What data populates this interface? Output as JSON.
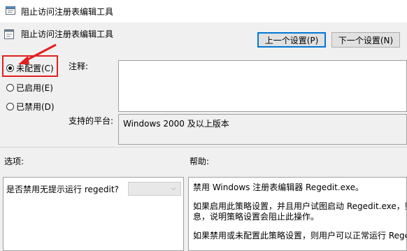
{
  "window": {
    "title": "阻止访问注册表编辑工具"
  },
  "header": {
    "title": "阻止访问注册表编辑工具"
  },
  "buttons": {
    "prev": "上一个设置(P)",
    "next": "下一个设置(N)"
  },
  "radios": [
    {
      "label": "未配置(C)",
      "checked": true
    },
    {
      "label": "已启用(E)",
      "checked": false
    },
    {
      "label": "已禁用(D)",
      "checked": false
    }
  ],
  "comment": {
    "label": "注释:",
    "value": ""
  },
  "platform": {
    "label": "支持的平台:",
    "value": "Windows 2000 及以上版本"
  },
  "options": {
    "label": "选项:",
    "item_label": "是否禁用无提示运行 regedit?",
    "dropdown_value": ""
  },
  "help": {
    "label": "帮助:",
    "lines": [
      "禁用 Windows 注册表编辑器 Regedit.exe。",
      "如果启用此策略设置，并且用户试图启动 Regedit.exe，则会",
      "息，说明策略设置会阻止此操作。",
      "如果禁用或未配置此策略设置，则用户可以正常运行 Regedi"
    ]
  },
  "colors": {
    "highlight": "#e02020",
    "focus": "#0078d7"
  }
}
